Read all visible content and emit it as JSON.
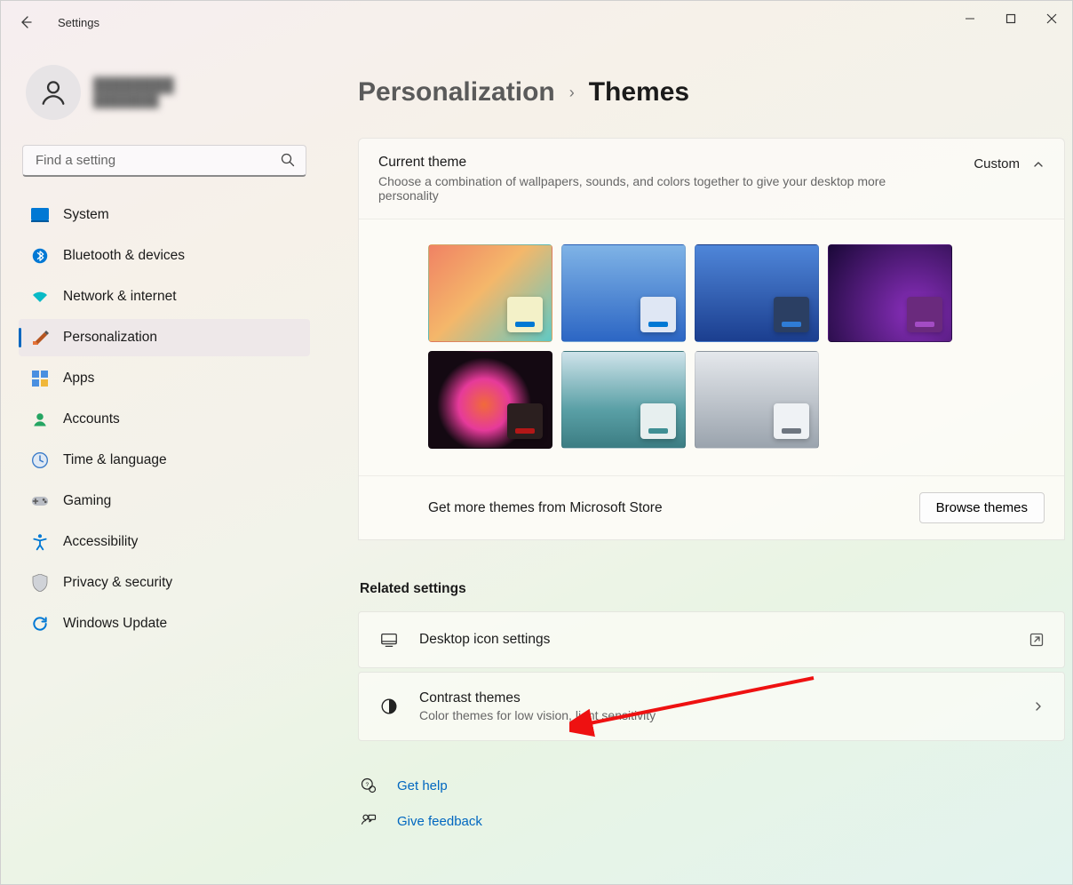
{
  "window": {
    "title": "Settings"
  },
  "user": {
    "name": "████████",
    "email": "████████"
  },
  "search": {
    "placeholder": "Find a setting"
  },
  "nav": [
    {
      "label": "System",
      "icon": "system"
    },
    {
      "label": "Bluetooth & devices",
      "icon": "bluetooth"
    },
    {
      "label": "Network & internet",
      "icon": "network"
    },
    {
      "label": "Personalization",
      "icon": "personalization",
      "active": true
    },
    {
      "label": "Apps",
      "icon": "apps"
    },
    {
      "label": "Accounts",
      "icon": "accounts"
    },
    {
      "label": "Time & language",
      "icon": "time"
    },
    {
      "label": "Gaming",
      "icon": "gaming"
    },
    {
      "label": "Accessibility",
      "icon": "accessibility"
    },
    {
      "label": "Privacy & security",
      "icon": "privacy"
    },
    {
      "label": "Windows Update",
      "icon": "update"
    }
  ],
  "breadcrumb": {
    "parent": "Personalization",
    "current": "Themes"
  },
  "currentTheme": {
    "title": "Current theme",
    "desc": "Choose a combination of wallpapers, sounds, and colors together to give your desktop more personality",
    "value": "Custom"
  },
  "themes": [
    {
      "bg": "linear-gradient(135deg,#f08264,#f4b76a 45%,#60c9c4)",
      "chipBg": "#f3f1c8",
      "accent": "#0078d4"
    },
    {
      "bg": "linear-gradient(180deg,#7fb3e6,#2c66c4)",
      "chipBg": "#dfe7f4",
      "accent": "#0078d4"
    },
    {
      "bg": "linear-gradient(180deg,#4f86d9,#1b3e8f)",
      "chipBg": "#2b3f63",
      "accent": "#2f7cd6"
    },
    {
      "bg": "radial-gradient(circle at 70% 70%,#8b2fbe,#1a0838)",
      "chipBg": "#6a2a7d",
      "accent": "#a34cc4"
    },
    {
      "bg": "radial-gradient(circle at 45% 55%,#f16a3a 0%,#e63a9a 30%,#140912 55%)",
      "chipBg": "#2b1f1f",
      "accent": "#b31717"
    },
    {
      "bg": "linear-gradient(180deg,#cfe3ea,#5aa0a6 60%,#3c7d83)",
      "chipBg": "#e7efef",
      "accent": "#3f8f94"
    },
    {
      "bg": "linear-gradient(180deg,#e5e8ec,#9aa3ad)",
      "chipBg": "#eff2f5",
      "accent": "#6e7680"
    }
  ],
  "store": {
    "text": "Get more themes from Microsoft Store",
    "button": "Browse themes"
  },
  "related": {
    "heading": "Related settings",
    "desktopIcons": {
      "title": "Desktop icon settings"
    },
    "contrast": {
      "title": "Contrast themes",
      "desc": "Color themes for low vision, light sensitivity"
    }
  },
  "help": {
    "getHelp": "Get help",
    "feedback": "Give feedback"
  }
}
